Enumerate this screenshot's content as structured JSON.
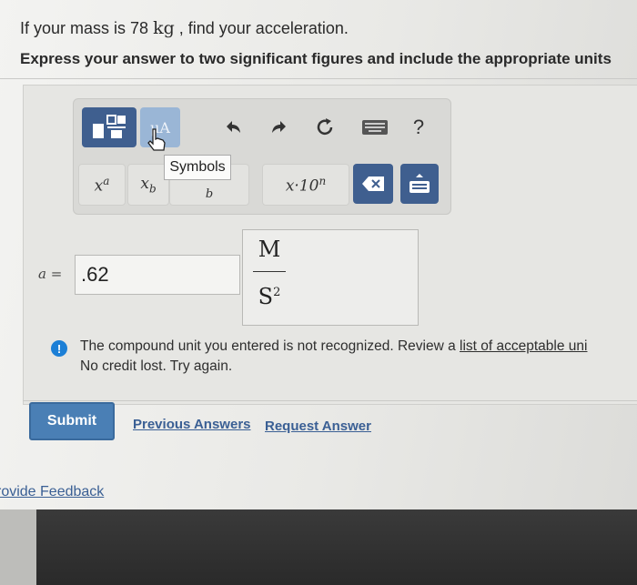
{
  "question": {
    "prefix": "If your mass is 78",
    "unit": "kg",
    "suffix": ", find your acceleration."
  },
  "instruction": "Express your answer to two significant figures and include the appropriate units",
  "toolbar": {
    "units_label": "μA",
    "help_label": "?",
    "sup_label": "x",
    "sup_exp": "a",
    "sub_label": "x",
    "sub_idx": "b",
    "symbols_sub": "b",
    "sci_label": "x·10",
    "sci_exp": "n",
    "tooltip": "Symbols"
  },
  "answer": {
    "variable_label": "a =",
    "value": ".62",
    "unit_numerator": "M",
    "unit_denominator": "S",
    "unit_denominator_exp": "2"
  },
  "feedback": {
    "message": "The compound unit you entered is not recognized. Review a",
    "link_text": "list of acceptable uni",
    "line2": "No credit lost. Try again."
  },
  "actions": {
    "submit": "Submit",
    "previous_answers": "Previous Answers",
    "request_answer": "Request Answer"
  },
  "footer": {
    "feedback_link": "rovide Feedback"
  },
  "colors": {
    "button_blue": "#3f5f8f",
    "submit_blue": "#4a7fb5",
    "info_blue": "#1c7fd6",
    "link": "#3a5f94"
  }
}
